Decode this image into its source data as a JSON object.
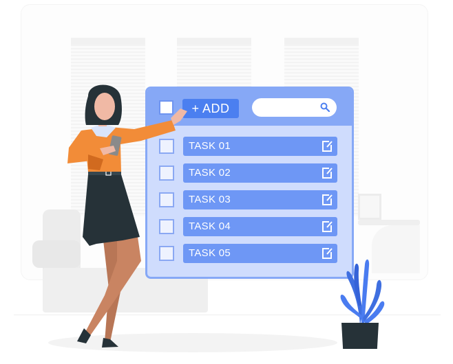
{
  "panel": {
    "add_button_label": "+ ADD",
    "search": {
      "value": "",
      "placeholder": ""
    },
    "tasks": [
      {
        "label": "TASK 01",
        "checked": false
      },
      {
        "label": "TASK 02",
        "checked": false
      },
      {
        "label": "TASK 03",
        "checked": false
      },
      {
        "label": "TASK 04",
        "checked": false
      },
      {
        "label": "TASK 05",
        "checked": false
      }
    ]
  },
  "icons": {
    "search": "search-icon",
    "edit": "edit-icon",
    "checkbox": "checkbox-icon"
  },
  "colors": {
    "panel_header": "#86a8f6",
    "panel_body": "#cfdcfd",
    "add_button": "#4b7ff0",
    "task_bar": "#6e97f5",
    "shirt": "#f28c38",
    "skirt": "#263238",
    "plant": "#4a7cf0",
    "pot": "#263238"
  }
}
